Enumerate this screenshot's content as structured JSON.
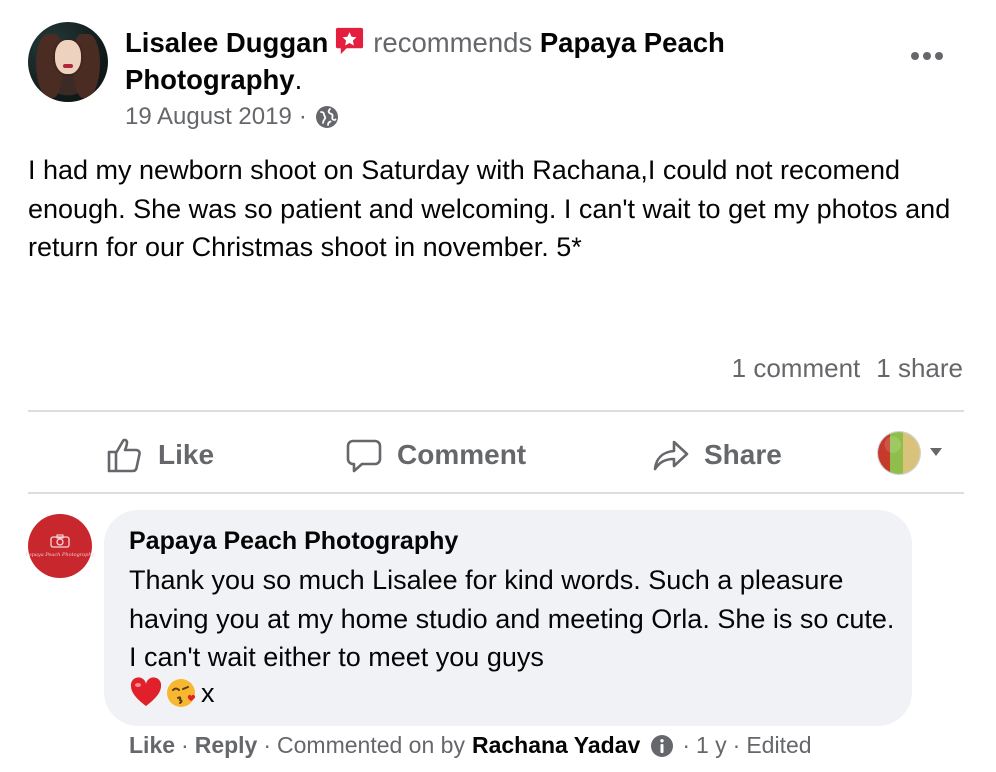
{
  "post": {
    "author": "Lisalee Duggan",
    "verb": "recommends",
    "page_name": "Papaya Peach Photography",
    "period": ".",
    "date": "19 August 2019",
    "date_sep": "·",
    "body": "I had my newborn shoot on Saturday with Rachana,I could not recomend enough. She was so patient and welcoming. I can't wait to get my photos and return for our Christmas shoot in november. 5*",
    "stats": {
      "comments": "1 comment",
      "shares": "1 share"
    }
  },
  "actions": {
    "like": "Like",
    "comment": "Comment",
    "share": "Share"
  },
  "comment": {
    "author": "Papaya Peach Photography",
    "avatar_caption": "Papaya Peach Photography",
    "text": "Thank you so much Lisalee for kind words. Such a pleasure having you at my home studio and meeting Orla. She is so cute. I can't wait either to meet you guys",
    "text_suffix": "x",
    "meta": {
      "like": "Like",
      "reply": "Reply",
      "commented_on_by": "Commented on by",
      "responder": "Rachana Yadav",
      "age": "1 y",
      "edited": "Edited",
      "dot": "·"
    }
  },
  "colors": {
    "muted": "#65676b",
    "text": "#050505",
    "bubble": "#f0f2f5",
    "badge": "#e41e3f",
    "brand_avatar": "#c8272e"
  },
  "icons": [
    "recommend-star-icon",
    "globe-icon",
    "more-options-icon",
    "like-thumb-icon",
    "comment-bubble-icon",
    "share-arrow-icon",
    "caret-down-icon",
    "camera-icon",
    "heart-emoji-icon",
    "kiss-emoji-icon",
    "info-icon"
  ]
}
